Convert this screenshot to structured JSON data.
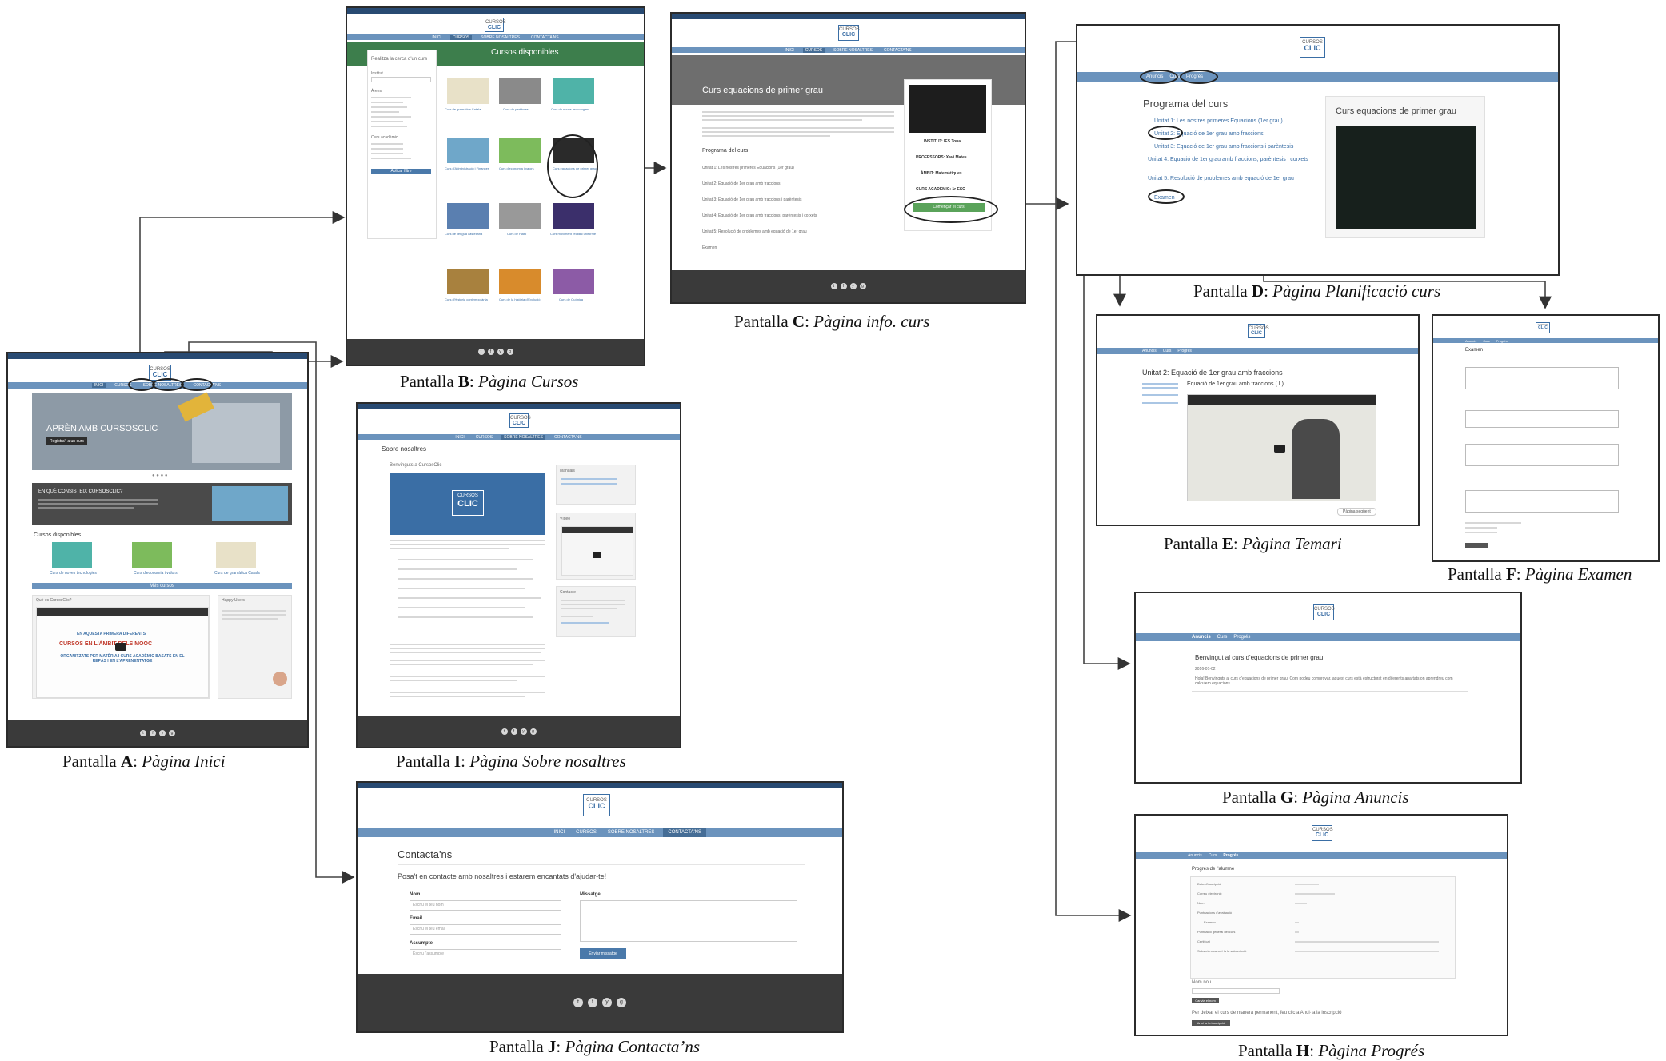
{
  "brand": {
    "line1": "CURSOS",
    "line2": "CLIC"
  },
  "captions": {
    "A": {
      "prefix": "Pantalla ",
      "letter": "A",
      "title": "Pàgina Inici"
    },
    "B": {
      "prefix": "Pantalla ",
      "letter": "B",
      "title": "Pàgina Cursos"
    },
    "C": {
      "prefix": "Pantalla ",
      "letter": "C",
      "title": "Pàgina info. curs"
    },
    "D": {
      "prefix": "Pantalla ",
      "letter": "D",
      "title": "Pàgina Planificació curs"
    },
    "E": {
      "prefix": "Pantalla ",
      "letter": "E",
      "title": "Pàgina Temari"
    },
    "F": {
      "prefix": "Pantalla ",
      "letter": "F",
      "title": "Pàgina Examen"
    },
    "G": {
      "prefix": "Pantalla ",
      "letter": "G",
      "title": "Pàgina Anuncis"
    },
    "H": {
      "prefix": "Pantalla ",
      "letter": "H",
      "title": "Pàgina Progrés"
    },
    "I": {
      "prefix": "Pantalla ",
      "letter": "I",
      "title": "Pàgina Sobre nosaltres"
    },
    "J": {
      "prefix": "Pantalla ",
      "letter": "J",
      "title": "Pàgina Contacta’ns"
    }
  },
  "nav": {
    "inici": "Inici",
    "cursos": "Cursos",
    "sobre": "Sobre nosaltres",
    "contacta": "Contacta'ns"
  },
  "course_nav": {
    "anuncis": "Anuncis",
    "curs": "Curs",
    "progres": "Progrés"
  },
  "screenA": {
    "banner": "APRÈN AMB CURSOSCLIC",
    "banner_btn": "Registra't a un curs",
    "question": "EN QUÈ CONSISTEIX CURSOSCLIC?",
    "available": "Cursos disponibles",
    "courses": [
      "Curs de noves tecnologies",
      "Curs d'economia i valors",
      "Curs de gramàtica Catala"
    ],
    "more": "Més cursos",
    "what": "Què és CursosClic?",
    "mooc1": "EN AQUESTA PRIMERA DIFERENTS",
    "mooc2": "CURSOS EN L'ÀMBIT DELS MOOC",
    "mooc3": "ORGANITZATS PER MATÈRIA I CURS ACADÈMIC BASATS EN EL REPÀS I EN L'APRENENTATGE",
    "happy": "Happy Users"
  },
  "screenB": {
    "title": "Cursos disponibles",
    "search": "Realitza la cerca d'un curs",
    "institut": "Institut",
    "arees": "Àrees",
    "curs": "Curs acadèmic",
    "filter_btn": "Aplicar filtre",
    "courses": [
      "Curs de gramàtica Catala",
      "Curs de partitures",
      "Curs de noves tecnologies",
      "Curs d'Administració i Finances",
      "Curs d'economia i valors",
      "Curs equacions de primer grau",
      "Curs de llengua castellana",
      "Curs de Plató",
      "Curs moviment rectilini uniforme",
      "Curs d'Història contemporània",
      "Curs de la història d'Evolució",
      "Curs de Química"
    ]
  },
  "screenC": {
    "title": "Curs equacions de primer grau",
    "program": "Programa del curs",
    "units": [
      "Unitat 1: Les nostres primeres Equacions (1er grau)",
      "Unitat 2: Equació de 1er grau amb fraccions",
      "Unitat 3: Equació de 1er grau amb fraccions i parèntesis",
      "Unitat 4: Equació de 1er grau amb fraccions, parèntesis i corxets",
      "Unitat 5: Resolució de problemes amb equació de 1er grau",
      "Examen"
    ],
    "institut": "INSTITUT: IES Tona",
    "professor": "PROFESSORS: Xavi Mates",
    "ambit": "ÀMBIT: Matemàtiques",
    "curs": "CURS ACADÈMIC: 1r ESO",
    "start_btn": "Començar el curs"
  },
  "screenD": {
    "program": "Programa del curs",
    "units": [
      "Unitat 1: Les nostres primeres Equacions (1er grau)",
      "Unitat 2: Equació de 1er grau amb fraccions",
      "Unitat 3: Equació de 1er grau amb fraccions i parèntesis",
      "Unitat 4: Equació de 1er grau amb fraccions, parèntesis i corxets",
      "Unitat 5: Resolució de problemes amb equació de 1er grau",
      "Examen"
    ],
    "course_title": "Curs equacions de primer grau"
  },
  "screenE": {
    "title": "Unitat 2: Equació de 1er grau amb fraccions",
    "video_title": "Equació de 1er grau amb fraccions ( I )",
    "next": "Pàgina següent"
  },
  "screenF": {
    "title": "Examen"
  },
  "screenG": {
    "title": "Benvingut al curs d'equacions de primer grau",
    "date": "2016-01-02",
    "body": "Hola! Benvinguts al curs d'equacions de primer grau. Com podeu comprovar, aquest curs està estructurat en diferents apartats on aprendreu com calculem equacions."
  },
  "screenH": {
    "title": "Progrés de l'alumne",
    "rows": [
      "Data d'inscripció",
      "Correu electrònic",
      "Nom",
      "Puntuacions d'avaluació",
      "Examen",
      "Puntuació general del curs",
      "Certificat",
      "Subscriu o cancel·la la subscripció"
    ],
    "nom_nou": "Nom nou",
    "change_btn": "Canvia el nom",
    "leave_text": "Per deixar el curs de manera permanent, feu clic a Anul·la la inscripció",
    "leave_btn": "Anul·la la inscripció"
  },
  "screenI": {
    "title": "Sobre nosaltres",
    "welcome": "Benvinguts a CursosClic",
    "manuals": "Manuals",
    "video": "Vídeo",
    "contact": "Contacte"
  },
  "screenJ": {
    "title": "Contacta'ns",
    "intro": "Posa't en contacte amb nosaltres i estarem encantats d'ajudar-te!",
    "nom": "Nom",
    "nom_ph": "Escriu el teu nom",
    "email": "Email",
    "email_ph": "Escriu el teu email",
    "assumpte": "Assumpte",
    "assumpte_ph": "Escriu l'assumpte",
    "missatge": "Missatge",
    "send_btn": "Enviar missatge"
  }
}
